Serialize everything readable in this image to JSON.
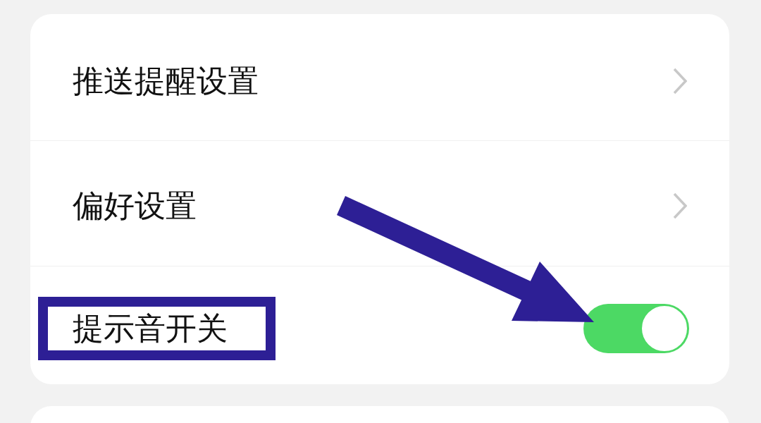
{
  "settings": {
    "rows": [
      {
        "kind": "link",
        "label": "推送提醒设置",
        "highlighted": false
      },
      {
        "kind": "link",
        "label": "偏好设置",
        "highlighted": false
      },
      {
        "kind": "toggle",
        "label": "提示音开关",
        "on": true,
        "highlighted": true
      }
    ]
  }
}
